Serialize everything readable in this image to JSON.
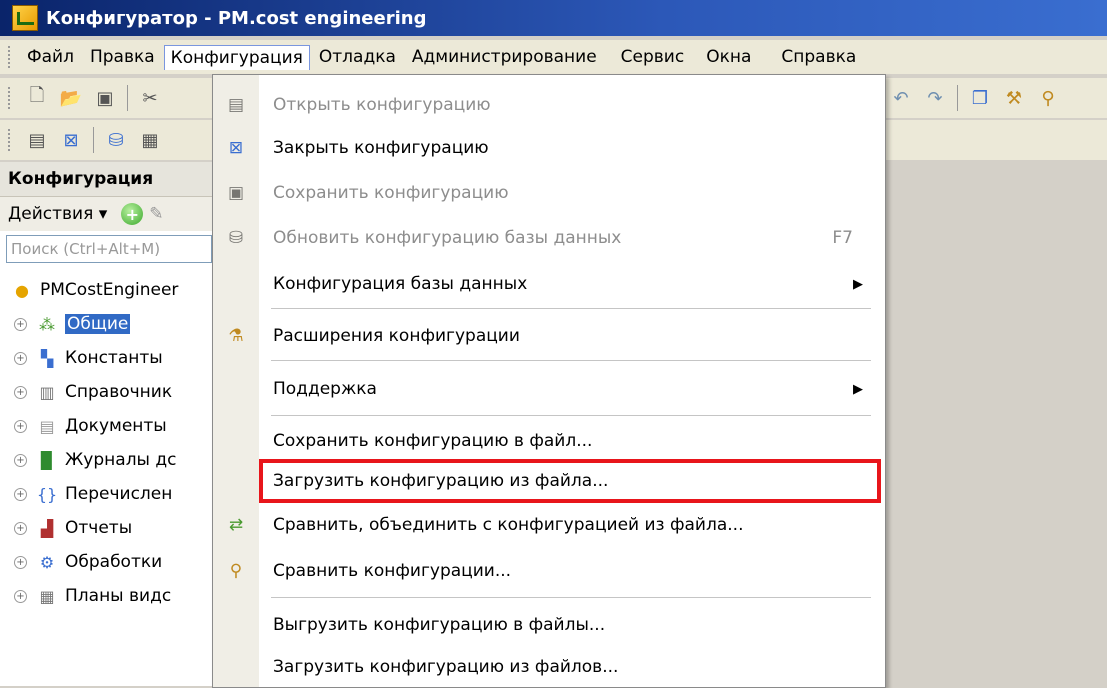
{
  "window": {
    "title": "Конфигуратор - PM.cost engineering"
  },
  "menubar": {
    "items": [
      {
        "label": "Файл"
      },
      {
        "label": "Правка"
      },
      {
        "label": "Конфигурация",
        "active": true
      },
      {
        "label": "Отладка"
      },
      {
        "label": "Администрирование"
      },
      {
        "label": "Сервис"
      },
      {
        "label": "Окна"
      },
      {
        "label": "Справка"
      }
    ]
  },
  "left_panel": {
    "header": "Конфигурация",
    "actions_label": "Действия ▾",
    "search_placeholder": "Поиск (Ctrl+Alt+M)",
    "tree": {
      "root": "PMCostEngineer",
      "nodes": [
        {
          "label": "Общие",
          "icon": "common-icon",
          "selected": true
        },
        {
          "label": "Константы",
          "icon": "constants-icon"
        },
        {
          "label": "Справочник",
          "icon": "catalogs-icon"
        },
        {
          "label": "Документы",
          "icon": "documents-icon"
        },
        {
          "label": "Журналы дс",
          "icon": "journals-icon"
        },
        {
          "label": "Перечислен",
          "icon": "enums-icon"
        },
        {
          "label": "Отчеты",
          "icon": "reports-icon"
        },
        {
          "label": "Обработки",
          "icon": "processing-icon"
        },
        {
          "label": "Планы видс",
          "icon": "plans-icon"
        }
      ]
    }
  },
  "dropdown": {
    "items": [
      {
        "label": "Открыть конфигурацию",
        "disabled": true,
        "icon": "open-config-icon"
      },
      {
        "label": "Закрыть конфигурацию",
        "disabled": false,
        "icon": "close-config-icon"
      },
      {
        "label": "Сохранить конфигурацию",
        "disabled": true,
        "icon": "save-config-icon"
      },
      {
        "label": "Обновить конфигурацию базы данных",
        "disabled": true,
        "icon": "update-db-icon",
        "shortcut": "F7"
      },
      {
        "label": "Конфигурация базы данных",
        "disabled": false,
        "submenu": true
      },
      {
        "label": "Расширения конфигурации",
        "disabled": false,
        "icon": "extensions-icon"
      },
      {
        "label": "Поддержка",
        "disabled": false,
        "submenu": true
      },
      {
        "label": "Сохранить конфигурацию в файл...",
        "disabled": false
      },
      {
        "label": "Загрузить конфигурацию из файла...",
        "disabled": false,
        "highlighted": true
      },
      {
        "label": "Сравнить, объединить с конфигурацией из файла...",
        "disabled": false,
        "icon": "compare-merge-icon"
      },
      {
        "label": "Сравнить конфигурации...",
        "disabled": false,
        "icon": "compare-icon"
      },
      {
        "label": "Выгрузить конфигурацию в файлы...",
        "disabled": false
      },
      {
        "label": "Загрузить конфигурацию из файлов...",
        "disabled": false
      }
    ]
  },
  "colors": {
    "highlight_border": "#e8151b",
    "title_bar": "#0a246a",
    "selection": "#316ac5"
  }
}
